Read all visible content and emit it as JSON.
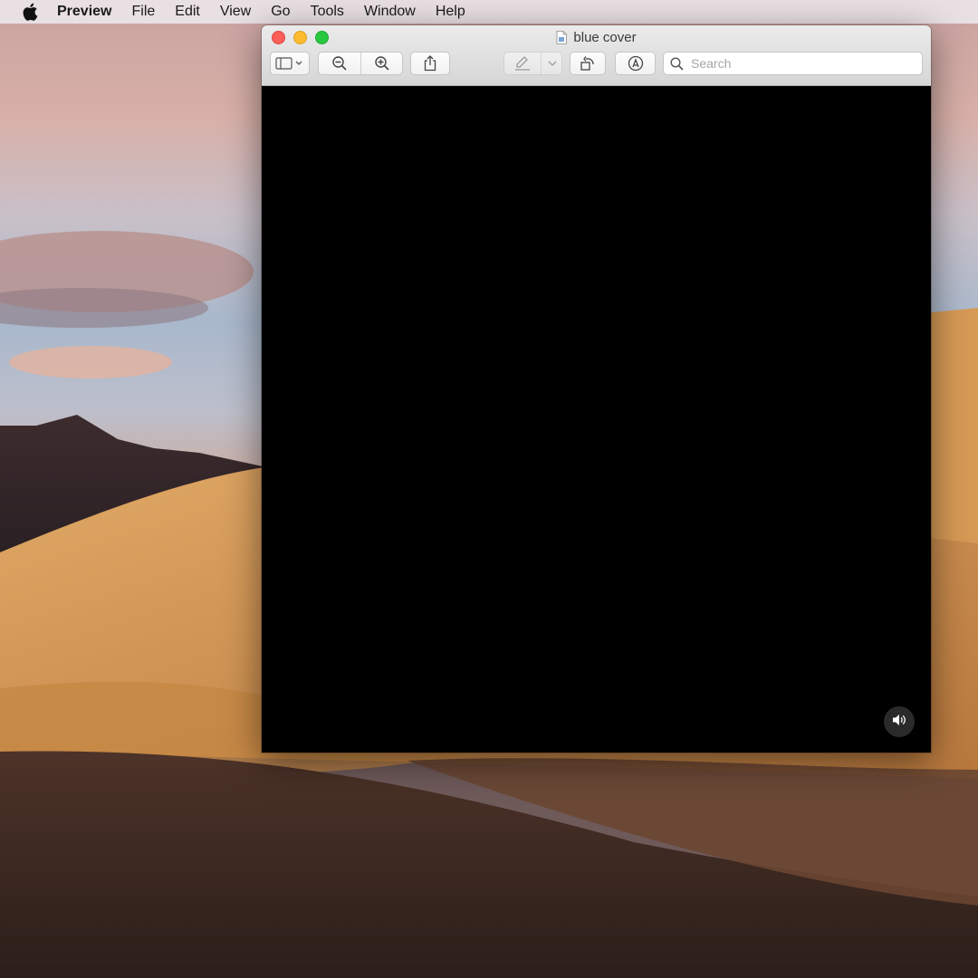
{
  "menubar": {
    "app_name": "Preview",
    "items": [
      "File",
      "Edit",
      "View",
      "Go",
      "Tools",
      "Window",
      "Help"
    ]
  },
  "window": {
    "title": "blue cover",
    "icons": {
      "sidebar": "sidebar-icon",
      "zoom_out": "zoom-out-icon",
      "zoom_in": "zoom-in-icon",
      "share": "share-icon",
      "highlight": "highlighter-icon",
      "rotate": "rotate-icon",
      "markup": "markup-icon",
      "search": "search-icon",
      "audio": "speaker-icon"
    },
    "search": {
      "placeholder": "Search",
      "value": ""
    }
  },
  "colors": {
    "close": "#fc5f57",
    "minimize": "#fdbc2e",
    "maximize": "#28c840",
    "content_bg": "#000000"
  }
}
